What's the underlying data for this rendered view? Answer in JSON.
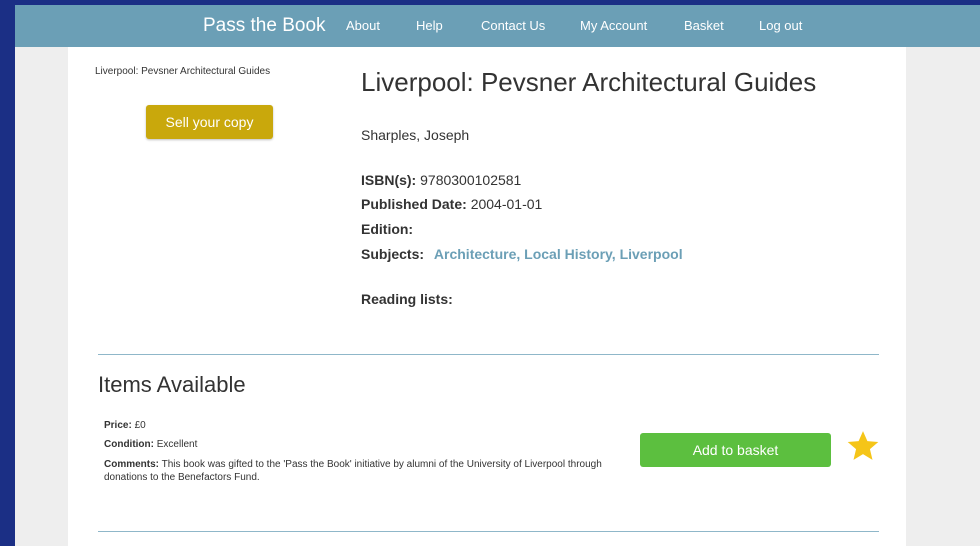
{
  "header": {
    "brand": "Pass the Book",
    "nav": [
      "About",
      "Help",
      "Contact Us",
      "My Account",
      "Basket",
      "Log out"
    ]
  },
  "sidebar": {
    "thumbnail_caption": "Liverpool: Pevsner Architectural Guides",
    "sell_button": "Sell your copy"
  },
  "book": {
    "title": "Liverpool: Pevsner Architectural Guides",
    "author": "Sharples, Joseph",
    "isbn_label": "ISBN(s):",
    "isbn": "9780300102581",
    "published_label": "Published Date:",
    "published": "2004-01-01",
    "edition_label": "Edition:",
    "edition": "",
    "subjects_label": "Subjects:",
    "subjects": "Architecture, Local History, Liverpool",
    "reading_lists_label": "Reading lists:"
  },
  "items": {
    "heading": "Items Available",
    "price_label": "Price:",
    "price": "£0",
    "condition_label": "Condition:",
    "condition": "Excellent",
    "comments_label": "Comments:",
    "comments": "This book was gifted to the 'Pass the Book' initiative by alumni of the University of Liverpool through donations to the Benefactors Fund.",
    "add_button": "Add to basket"
  },
  "colors": {
    "header": "#6b9fb6",
    "sell_button": "#c9a80c",
    "add_button": "#5cbf3f",
    "star": "#f5c518",
    "link": "#6b9fb6"
  },
  "icons": {
    "favourite": "star-icon"
  }
}
